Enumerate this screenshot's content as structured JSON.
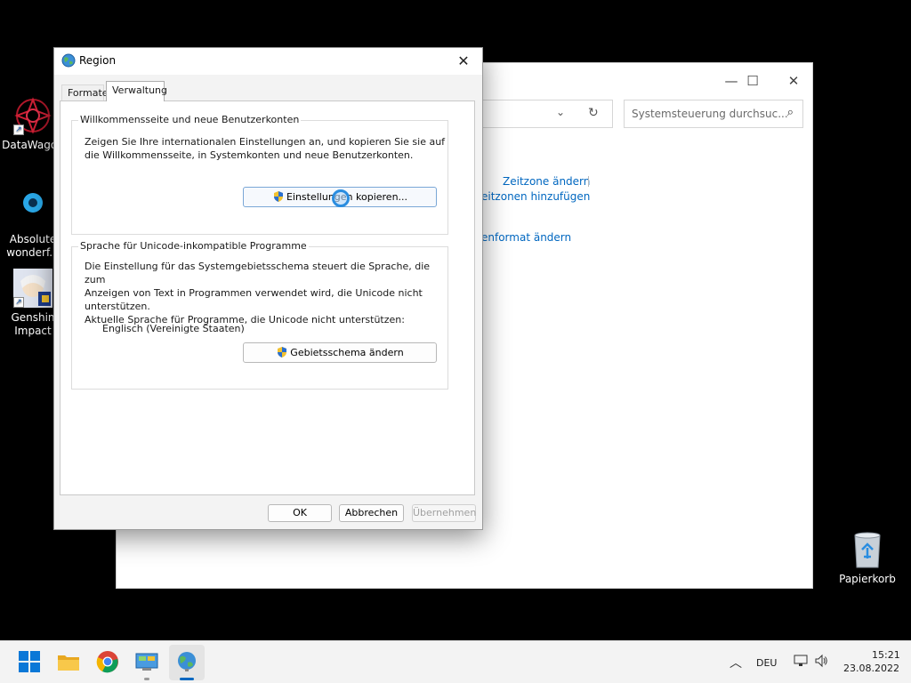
{
  "desktop": {
    "icons": [
      {
        "label_lines": [
          "DataWagon"
        ]
      },
      {
        "label_lines": [
          "Absolute",
          "wonderf..."
        ]
      },
      {
        "label_lines": [
          "Genshin",
          "Impact"
        ]
      }
    ],
    "recycle_bin": "Papierkorb"
  },
  "background_window": {
    "search_placeholder": "Systemsteuerung durchsuc...",
    "links": [
      "Zeitzone ändern",
      "eitzonen hinzufügen",
      "enformat ändern"
    ]
  },
  "dialog": {
    "title": "Region",
    "tabs": [
      {
        "label": "Formate",
        "active": false
      },
      {
        "label": "Verwaltung",
        "active": true
      }
    ],
    "group1": {
      "title": "Willkommensseite und neue Benutzerkonten",
      "description": [
        "Zeigen Sie Ihre internationalen Einstellungen an, und kopieren Sie sie auf",
        "die Willkommensseite, in Systemkonten und neue Benutzerkonten."
      ],
      "button": "Einstellungen kopieren..."
    },
    "group2": {
      "title": "Sprache für Unicode-inkompatible Programme",
      "description": [
        "Die Einstellung für das Systemgebietsschema steuert die Sprache, die zum",
        "Anzeigen von Text in Programmen verwendet wird, die Unicode nicht",
        "unterstützen."
      ],
      "current_label": "Aktuelle Sprache für Programme, die Unicode nicht unterstützen:",
      "current_value": "Englisch (Vereinigte Staaten)",
      "button": "Gebietsschema ändern"
    },
    "footer": {
      "ok": "OK",
      "cancel": "Abbrechen",
      "apply": "Übernehmen"
    }
  },
  "taskbar": {
    "language": "DEU",
    "time": "15:21",
    "date": "23.08.2022"
  },
  "colors": {
    "accent": "#0067c0",
    "taskbar": "#f3f3f3",
    "desktop": "#000000"
  }
}
